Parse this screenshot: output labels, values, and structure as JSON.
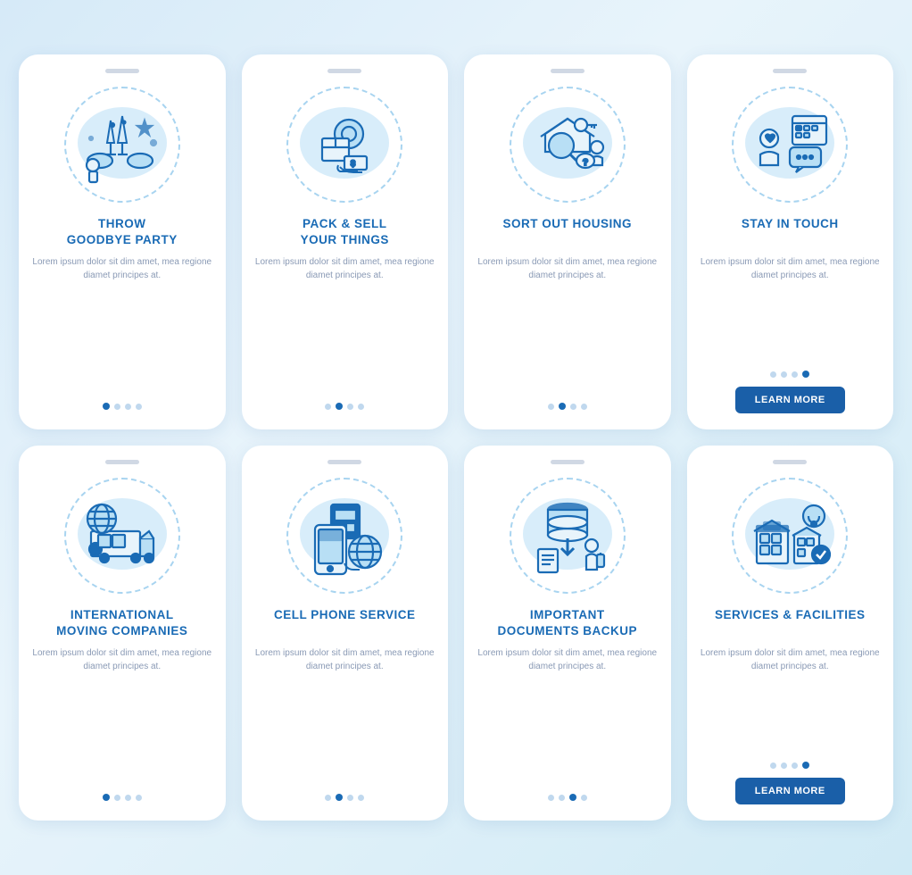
{
  "cards": [
    {
      "id": "throw-goodbye-party",
      "title": "THROW\nGOODBYE PARTY",
      "body": "Lorem ipsum dolor sit dim amet, mea regione diamet principes at.",
      "dots": [
        1,
        0,
        0,
        0
      ],
      "showButton": false,
      "icon": "party"
    },
    {
      "id": "pack-sell",
      "title": "PACK & SELL\nYOUR THINGS",
      "body": "Lorem ipsum dolor sit dim amet, mea regione diamet principes at.",
      "dots": [
        0,
        1,
        0,
        0
      ],
      "showButton": false,
      "icon": "pack"
    },
    {
      "id": "sort-housing",
      "title": "SORT OUT HOUSING",
      "body": "Lorem ipsum dolor sit dim amet, mea regione diamet principes at.",
      "dots": [
        0,
        1,
        0,
        0
      ],
      "showButton": false,
      "icon": "housing"
    },
    {
      "id": "stay-in-touch",
      "title": "STAY IN TOUCH",
      "body": "Lorem ipsum dolor sit dim amet, mea regione diamet principes at.",
      "dots": [
        0,
        0,
        0,
        1
      ],
      "showButton": true,
      "buttonLabel": "LEARN MORE",
      "icon": "touch"
    },
    {
      "id": "international-moving",
      "title": "INTERNATIONAL\nMOVING COMPANIES",
      "body": "Lorem ipsum dolor sit dim amet, mea regione diamet principes at.",
      "dots": [
        1,
        0,
        0,
        0
      ],
      "showButton": false,
      "icon": "moving"
    },
    {
      "id": "cell-phone",
      "title": "CELL PHONE SERVICE",
      "body": "Lorem ipsum dolor sit dim amet, mea regione diamet principes at.",
      "dots": [
        0,
        1,
        0,
        0
      ],
      "showButton": false,
      "icon": "phone"
    },
    {
      "id": "documents-backup",
      "title": "IMPORTANT\nDOCUMENTS BACKUP",
      "body": "Lorem ipsum dolor sit dim amet, mea regione diamet principes at.",
      "dots": [
        0,
        0,
        1,
        0
      ],
      "showButton": false,
      "icon": "documents"
    },
    {
      "id": "services-facilities",
      "title": "SERVICES & FACILITIES",
      "body": "Lorem ipsum dolor sit dim amet, mea regione diamet principes at.",
      "dots": [
        0,
        0,
        0,
        1
      ],
      "showButton": true,
      "buttonLabel": "LEARN MORE",
      "icon": "facilities"
    }
  ]
}
